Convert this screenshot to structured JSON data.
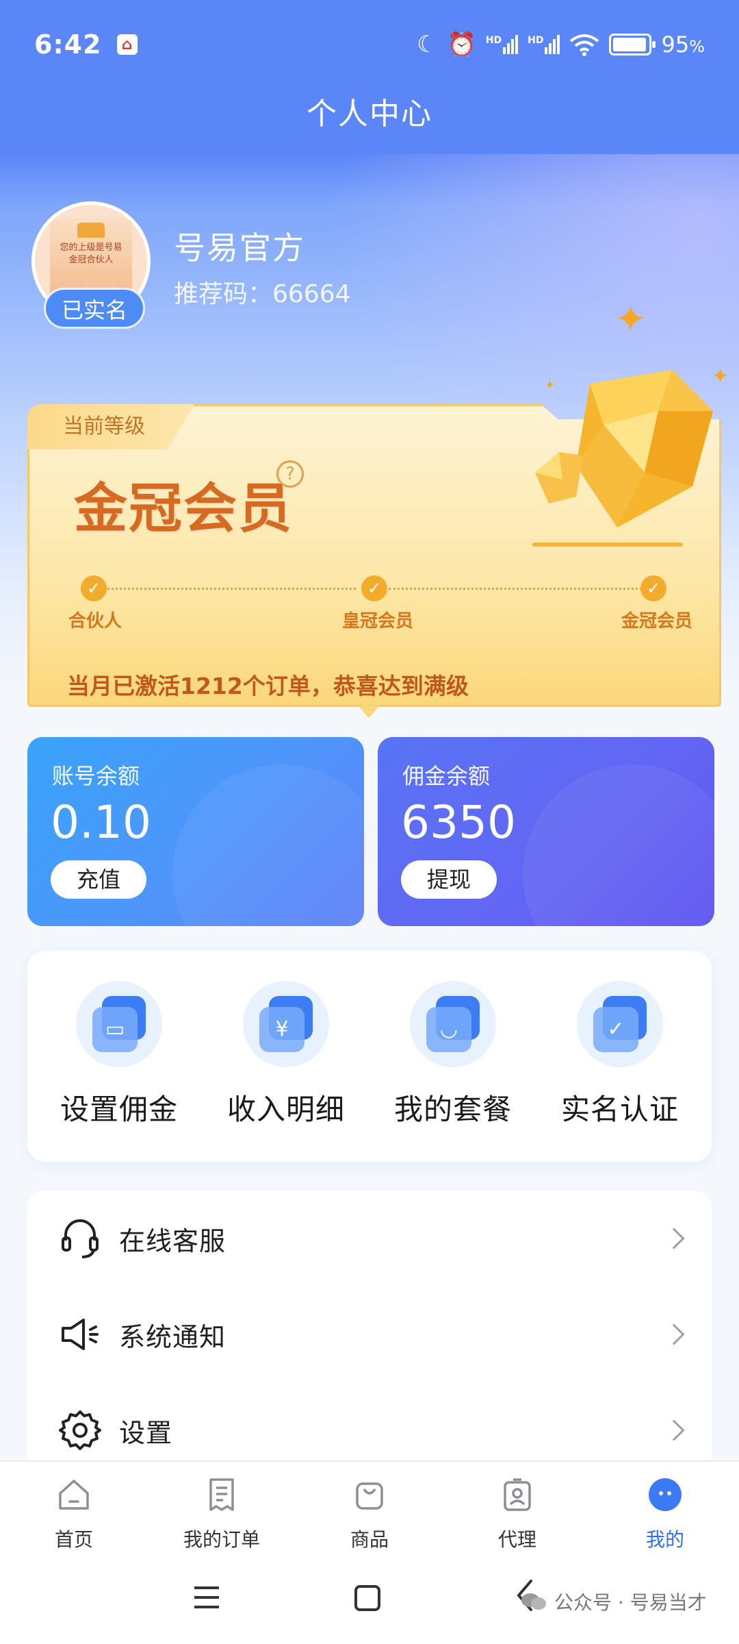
{
  "status_bar": {
    "time": "6:42",
    "battery_percent": "95",
    "battery_unit": "%",
    "signal1": "HD",
    "signal2": "HD"
  },
  "header": {
    "title": "个人中心"
  },
  "profile": {
    "name": "号易官方",
    "referral_code": "推荐码：66664",
    "verified_badge": "已实名",
    "avatar_text": [
      "您的上级是号易",
      "金冠合伙人"
    ]
  },
  "level_card": {
    "tab_label": "当前等级",
    "level_name": "金冠会员",
    "help": "?",
    "progress_fraction": 1.0,
    "steps": [
      "合伙人",
      "皇冠会员",
      "金冠会员"
    ],
    "message": "当月已激活1212个订单，恭喜达到满级"
  },
  "balances": {
    "account": {
      "label": "账号余额",
      "value": "0.10",
      "action": "充值"
    },
    "commission": {
      "label": "佣金余额",
      "value": "6350",
      "action": "提现"
    }
  },
  "quick_actions": [
    {
      "label": "设置佣金",
      "icon": "wallet-icon",
      "glyph": "▭"
    },
    {
      "label": "收入明细",
      "icon": "money-bag-icon",
      "glyph": "¥"
    },
    {
      "label": "我的套餐",
      "icon": "shopping-bag-icon",
      "glyph": "◡"
    },
    {
      "label": "实名认证",
      "icon": "user-verified-icon",
      "glyph": "✓"
    }
  ],
  "menu": [
    {
      "label": "在线客服",
      "icon": "headset-icon"
    },
    {
      "label": "系统通知",
      "icon": "speaker-icon"
    },
    {
      "label": "设置",
      "icon": "gear-icon"
    }
  ],
  "bottom_nav": [
    {
      "label": "首页",
      "icon": "home-icon",
      "active": false
    },
    {
      "label": "我的订单",
      "icon": "order-icon",
      "active": false
    },
    {
      "label": "商品",
      "icon": "bag-icon",
      "active": false
    },
    {
      "label": "代理",
      "icon": "agent-icon",
      "active": false
    },
    {
      "label": "我的",
      "icon": "profile-icon",
      "active": true
    }
  ],
  "watermark": "公众号 · 号易当才",
  "colors": {
    "primary": "#5b86f7",
    "accent_gold": "#f3ab2c",
    "active_nav": "#2f6ef2"
  }
}
